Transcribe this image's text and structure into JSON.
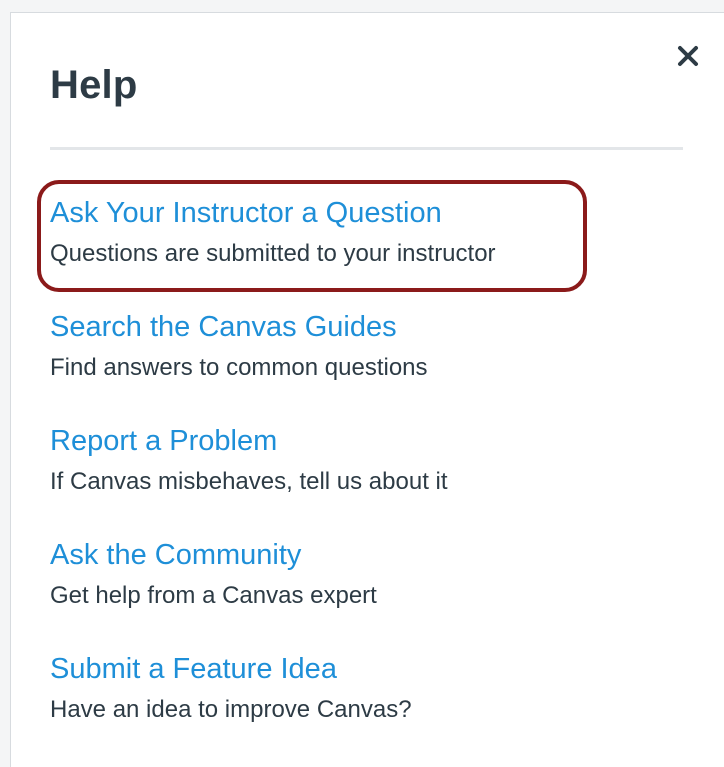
{
  "help_tray": {
    "title": "Help",
    "close_label": "×",
    "items": [
      {
        "link": "Ask Your Instructor a Question",
        "description": "Questions are submitted to your instructor"
      },
      {
        "link": "Search the Canvas Guides",
        "description": "Find answers to common questions"
      },
      {
        "link": "Report a Problem",
        "description": "If Canvas misbehaves, tell us about it"
      },
      {
        "link": "Ask the Community",
        "description": "Get help from a Canvas expert"
      },
      {
        "link": "Submit a Feature Idea",
        "description": "Have an idea to improve Canvas?"
      }
    ]
  },
  "colors": {
    "link": "#1e8fd8",
    "text": "#2d3b45",
    "highlight_border": "#8b1a1a"
  },
  "annotation": {
    "highlighted_item": "Ask Your Instructor a Question"
  }
}
